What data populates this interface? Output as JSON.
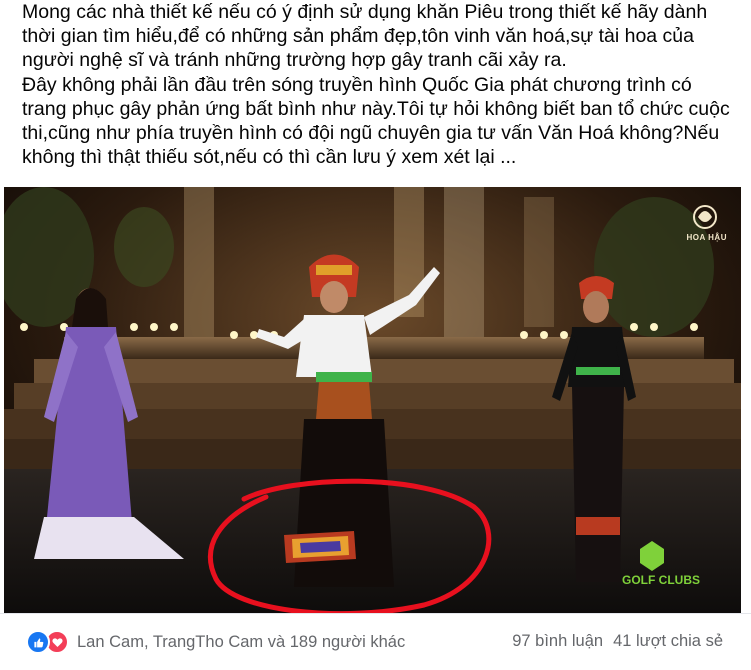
{
  "post": {
    "paragraph_1": "Mong các nhà thiết kế nếu có ý định sử dụng khăn Piêu trong thiết kế hãy dành thời gian tìm hiểu,để có những sản phẩm đẹp,tôn vinh văn hoá,sự tài hoa của người nghệ sĩ và tránh những trường hợp gây tranh cãi xảy ra.",
    "paragraph_2": "Đây không phải lần đầu trên sóng truyền hình Quốc Gia phát chương trình có trang phục gây phản ứng bất bình như này.Tôi tự hỏi không biết ban tổ chức cuộc thi,cũng như phía truyền hình có đội ngũ chuyên gia tư vấn Văn Hoá không?Nếu không thì thật thiếu sót,nếu có thì cần lưu ý xem xét lại ..."
  },
  "photo": {
    "watermark_text": "HOA HẬU",
    "sponsor_text": "GOLF CLUBS",
    "highlight_color": "#e8101e"
  },
  "footer": {
    "reaction_icons": [
      "like-icon",
      "love-icon"
    ],
    "reactors_text": "Lan Cam, TrangTho Cam và 189 người khác",
    "comments_text": "97 bình luận",
    "shares_text": "41 lượt chia sẻ"
  },
  "colors": {
    "text_primary": "#050505",
    "text_secondary": "#65676b",
    "like_blue": "#1877f2",
    "love_red": "#f33e58"
  }
}
